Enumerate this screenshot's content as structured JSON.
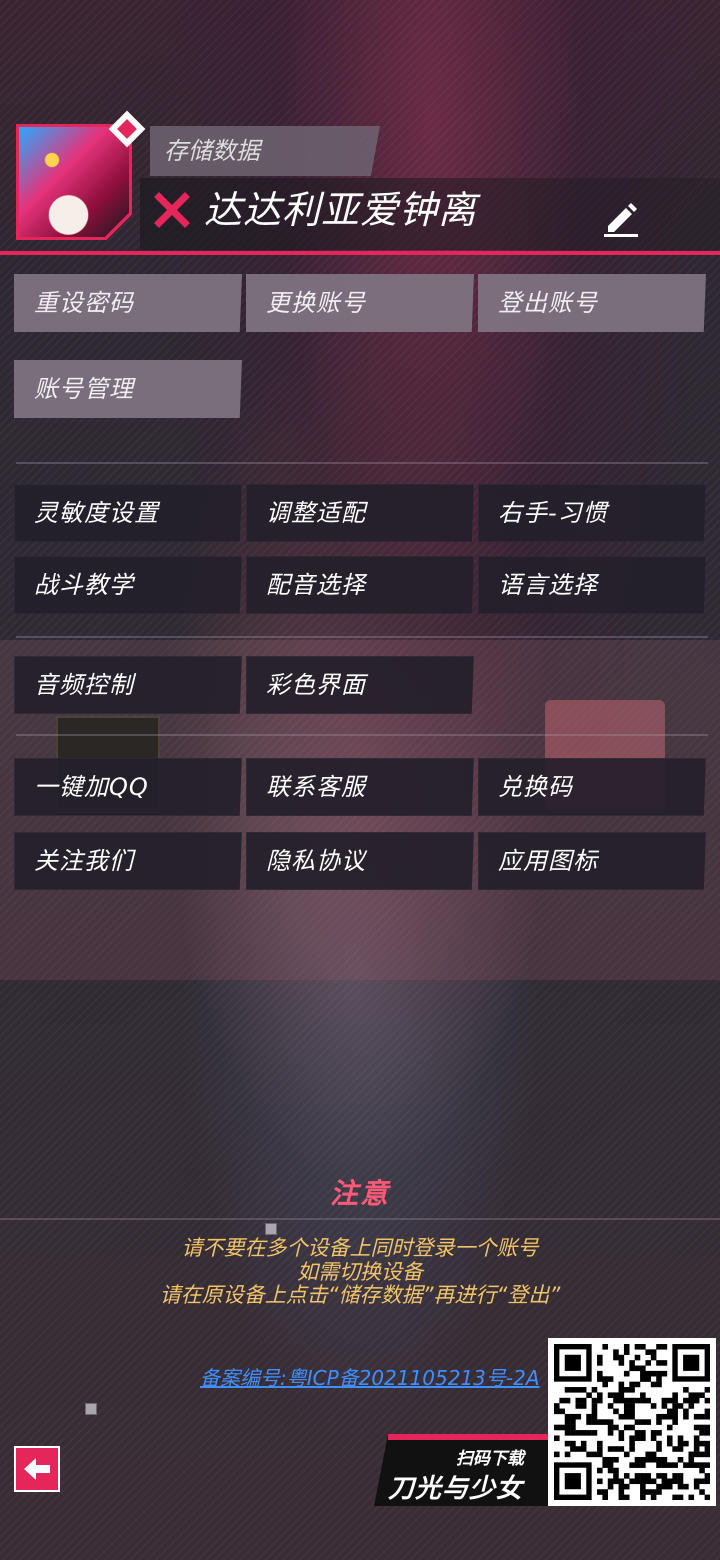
{
  "header": {
    "save_label": "存储数据",
    "player_name": "达达利亚爱钟离"
  },
  "account_buttons": [
    {
      "label": "重设密码"
    },
    {
      "label": "更换账号"
    },
    {
      "label": "登出账号"
    },
    {
      "label": "账号管理"
    }
  ],
  "settings_buttons": [
    {
      "label": "灵敏度设置"
    },
    {
      "label": "调整适配"
    },
    {
      "label": "右手-习惯"
    },
    {
      "label": "战斗教学"
    },
    {
      "label": "配音选择"
    },
    {
      "label": "语言选择"
    }
  ],
  "display_buttons": [
    {
      "label": "音频控制"
    },
    {
      "label": "彩色界面"
    }
  ],
  "service_buttons": [
    {
      "label": "一键加QQ"
    },
    {
      "label": "联系客服"
    },
    {
      "label": "兑换码"
    },
    {
      "label": "关注我们"
    },
    {
      "label": "隐私协议"
    },
    {
      "label": "应用图标"
    }
  ],
  "notice": {
    "title": "注意",
    "lines": [
      "请不要在多个设备上同时登录一个账号",
      "如需切换设备",
      "请在原设备上点击“储存数据”再进行“登出”"
    ],
    "icp": "备案编号:粤ICP备2021105213号-2A"
  },
  "download": {
    "sub": "扫码下载",
    "title": "刀光与少女"
  },
  "colors": {
    "accent": "#e4265a",
    "notice_title": "#ff5a78",
    "notice_text": "#f2c46a",
    "link": "#3f8fff"
  },
  "icons": {
    "status": "close-icon",
    "edit": "pencil-icon",
    "back": "back-arrow-icon"
  }
}
